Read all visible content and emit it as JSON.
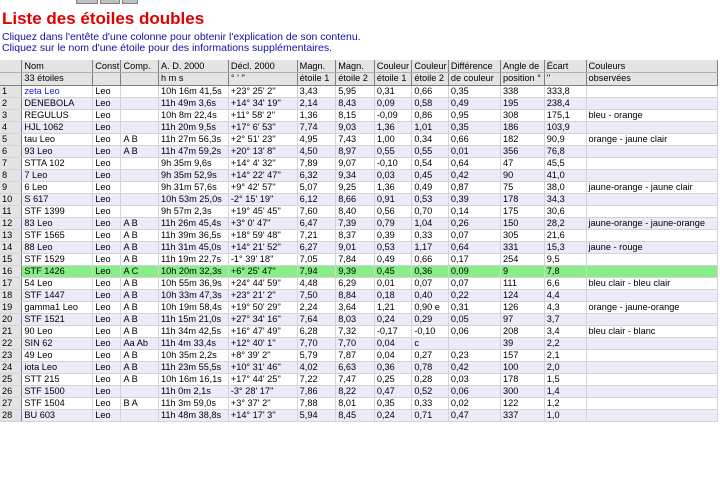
{
  "page": {
    "title": "Liste des étoiles doubles",
    "instruction_1": "Cliquez dans l'entête d'une colonne pour obtenir l'explication de son contenu.",
    "instruction_2": "Cliquez sur le nom d'une étoile pour des informations supplémentaires."
  },
  "colors": {
    "title": "#e00000",
    "instructions": "#1010a0",
    "selected_row": "#88ee88",
    "alt_row": "#ecebf8",
    "link": "#1a1aff"
  },
  "table": {
    "headers": [
      "Nom",
      "Const.",
      "Comp.",
      "A. D. 2000",
      "Décl. 2000",
      "Magn.",
      "Magn.",
      "Couleur",
      "Couleur",
      "Différence",
      "Angle de",
      "Écart",
      "Couleurs"
    ],
    "subheaders": [
      "33 étoiles",
      "",
      "",
      "h  m  s",
      "°  '  ''",
      "étoile 1",
      "étoile 2",
      "étoile 1",
      "étoile 2",
      "de couleur",
      "position °",
      "''",
      "observées"
    ],
    "selected_row": 16,
    "rows": [
      [
        "1",
        "zeta Leo",
        "Leo",
        "",
        "10h 16m 41,5s",
        "+23° 25' 2''",
        "3,43",
        "5,95",
        "0,31",
        "0,66",
        "0,35",
        "338",
        "333,8",
        ""
      ],
      [
        "2",
        "DENEBOLA",
        "Leo",
        "",
        "11h 49m 3,6s",
        "+14° 34' 19''",
        "2,14",
        "8,43",
        "0,09",
        "0,58",
        "0,49",
        "195",
        "238,4",
        ""
      ],
      [
        "3",
        "REGULUS",
        "Leo",
        "",
        "10h 8m 22,4s",
        "+11° 58' 2''",
        "1,36",
        "8,15",
        "-0,09",
        "0,86",
        "0,95",
        "308",
        "175,1",
        "bleu  -  orange"
      ],
      [
        "4",
        "HJL 1062",
        "Leo",
        "",
        "11h 20m 9,5s",
        "+17° 6' 53''",
        "7,74",
        "9,03",
        "1,36",
        "1,01",
        "0,35",
        "186",
        "103,9",
        ""
      ],
      [
        "5",
        "tau Leo",
        "Leo",
        "A  B",
        "11h 27m 56,3s",
        "+2° 51' 23''",
        "4,95",
        "7,43",
        "1,00",
        "0,34",
        "0,66",
        "182",
        "90,9",
        "orange  -  jaune clair"
      ],
      [
        "6",
        "93 Leo",
        "Leo",
        "A  B",
        "11h 47m 59,2s",
        "+20° 13' 8''",
        "4,50",
        "8,97",
        "0,55",
        "0,55",
        "0,01",
        "356",
        "76,8",
        ""
      ],
      [
        "7",
        "STTA 102",
        "Leo",
        "",
        "9h 35m 9,6s",
        "+14° 4' 32''",
        "7,89",
        "9,07",
        "-0,10",
        "0,54",
        "0,64",
        "47",
        "45,5",
        ""
      ],
      [
        "8",
        "7 Leo",
        "Leo",
        "",
        "9h 35m 52,9s",
        "+14° 22' 47''",
        "6,32",
        "9,34",
        "0,03",
        "0,45",
        "0,42",
        "90",
        "41,0",
        ""
      ],
      [
        "9",
        "6 Leo",
        "Leo",
        "",
        "9h 31m 57,6s",
        "+9° 42' 57''",
        "5,07",
        "9,25",
        "1,36",
        "0,49",
        "0,87",
        "75",
        "38,0",
        "jaune-orange  -  jaune clair"
      ],
      [
        "10",
        "S 617",
        "Leo",
        "",
        "10h 53m 25,0s",
        "-2° 15' 19''",
        "6,12",
        "8,66",
        "0,91",
        "0,53",
        "0,39",
        "178",
        "34,3",
        ""
      ],
      [
        "11",
        "STF 1399",
        "Leo",
        "",
        "9h 57m 2,3s",
        "+19° 45' 45''",
        "7,60",
        "8,40",
        "0,56",
        "0,70",
        "0,14",
        "175",
        "30,6",
        ""
      ],
      [
        "12",
        "83 Leo",
        "Leo",
        "A  B",
        "11h 26m 45,4s",
        "+3° 0' 47''",
        "6,47",
        "7,39",
        "0,79",
        "1,04",
        "0,26",
        "150",
        "28,2",
        "jaune-orange  -  jaune-orange"
      ],
      [
        "13",
        "STF 1565",
        "Leo",
        "A  B",
        "11h 39m 36,5s",
        "+18° 59' 48''",
        "7,21",
        "8,37",
        "0,39",
        "0,33",
        "0,07",
        "305",
        "21,6",
        ""
      ],
      [
        "14",
        "88 Leo",
        "Leo",
        "A  B",
        "11h 31m 45,0s",
        "+14° 21' 52''",
        "6,27",
        "9,01",
        "0,53",
        "1,17",
        "0,64",
        "331",
        "15,3",
        "jaune  -  rouge"
      ],
      [
        "15",
        "STF 1529",
        "Leo",
        "A  B",
        "11h 19m 22,7s",
        "-1° 39' 18''",
        "7,05",
        "7,84",
        "0,49",
        "0,66",
        "0,17",
        "254",
        "9,5",
        ""
      ],
      [
        "16",
        "STF 1426",
        "Leo",
        "A  C",
        "10h 20m 32,3s",
        "+6° 25' 47''",
        "7,94",
        "9,39",
        "0,45",
        "0,36",
        "0,09",
        "9",
        "7,8",
        ""
      ],
      [
        "17",
        "54 Leo",
        "Leo",
        "A  B",
        "10h 55m 36,9s",
        "+24° 44' 59''",
        "4,48",
        "6,29",
        "0,01",
        "0,07",
        "0,07",
        "111",
        "6,6",
        "bleu clair  -  bleu clair"
      ],
      [
        "18",
        "STF 1447",
        "Leo",
        "A  B",
        "10h 33m 47,3s",
        "+23° 21' 2''",
        "7,50",
        "8,84",
        "0,18",
        "0,40",
        "0,22",
        "124",
        "4,4",
        ""
      ],
      [
        "19",
        "gamma1 Leo",
        "Leo",
        "A  B",
        "10h 19m 58,4s",
        "+19° 50' 29''",
        "2,24",
        "3,64",
        "1,21",
        "0,90 e",
        "0,31",
        "126",
        "4,3",
        "orange  -  jaune-orange"
      ],
      [
        "20",
        "STF 1521",
        "Leo",
        "A  B",
        "11h 15m 21,0s",
        "+27° 34' 16''",
        "7,64",
        "8,03",
        "0,24",
        "0,29",
        "0,05",
        "97",
        "3,7",
        ""
      ],
      [
        "21",
        "90 Leo",
        "Leo",
        "A  B",
        "11h 34m 42,5s",
        "+16° 47' 49''",
        "6,28",
        "7,32",
        "-0,17",
        "-0,10",
        "0,06",
        "208",
        "3,4",
        "bleu clair  -  blanc"
      ],
      [
        "22",
        "SIN 62",
        "Leo",
        "Aa  Ab",
        "11h 4m 33,4s",
        "+12° 40' 1''",
        "7,70",
        "7,70",
        "0,04",
        "c",
        "",
        "39",
        "2,2",
        ""
      ],
      [
        "23",
        "49 Leo",
        "Leo",
        "A  B",
        "10h 35m 2,2s",
        "+8° 39' 2''",
        "5,79",
        "7,87",
        "0,04",
        "0,27",
        "0,23",
        "157",
        "2,1",
        ""
      ],
      [
        "24",
        "iota Leo",
        "Leo",
        "A  B",
        "11h 23m 55,5s",
        "+10° 31' 46''",
        "4,02",
        "6,63",
        "0,36",
        "0,78",
        "0,42",
        "100",
        "2,0",
        ""
      ],
      [
        "25",
        "STT 215",
        "Leo",
        "A  B",
        "10h 16m 16,1s",
        "+17° 44' 25''",
        "7,22",
        "7,47",
        "0,25",
        "0,28",
        "0,03",
        "178",
        "1,5",
        ""
      ],
      [
        "26",
        "STF 1500",
        "Leo",
        "",
        "11h 0m 2,1s",
        "-3° 28' 17''",
        "7,86",
        "8,22",
        "0,47",
        "0,52",
        "0,06",
        "300",
        "1,4",
        ""
      ],
      [
        "27",
        "STF 1504",
        "Leo",
        "B  A",
        "11h 3m 59,0s",
        "+3° 37' 2''",
        "7,88",
        "8,01",
        "0,35",
        "0,33",
        "0,02",
        "122",
        "1,2",
        ""
      ],
      [
        "28",
        "BU 603",
        "Leo",
        "",
        "11h 48m 38,8s",
        "+14° 17' 3''",
        "5,94",
        "8,45",
        "0,24",
        "0,71",
        "0,47",
        "337",
        "1,0",
        ""
      ]
    ]
  }
}
